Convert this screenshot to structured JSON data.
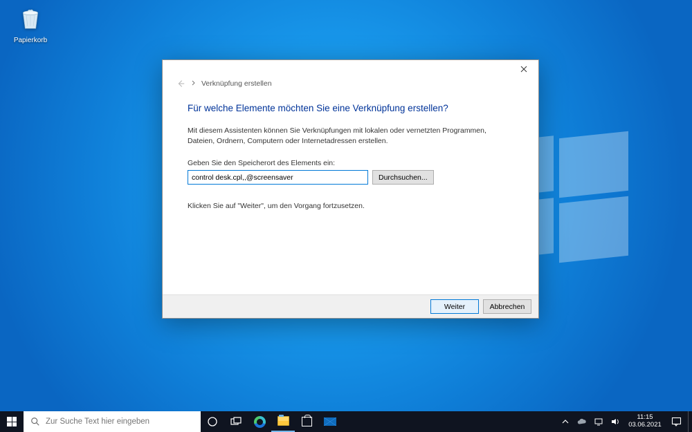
{
  "desktop": {
    "recycle_bin_label": "Papierkorb"
  },
  "dialog": {
    "breadcrumb_title": "Verknüpfung erstellen",
    "heading": "Für welche Elemente möchten Sie eine Verknüpfung erstellen?",
    "description": "Mit diesem Assistenten können Sie Verknüpfungen mit lokalen oder vernetzten Programmen, Dateien, Ordnern, Computern oder Internetadressen erstellen.",
    "location_label": "Geben Sie den Speicherort des Elements ein:",
    "location_value": "control desk.cpl,,@screensaver",
    "browse_label": "Durchsuchen...",
    "continue_hint": "Klicken Sie auf \"Weiter\", um den Vorgang fortzusetzen.",
    "next_label": "Weiter",
    "cancel_label": "Abbrechen"
  },
  "taskbar": {
    "search_placeholder": "Zur Suche Text hier eingeben",
    "time": "11:15",
    "date": "03.06.2021"
  }
}
